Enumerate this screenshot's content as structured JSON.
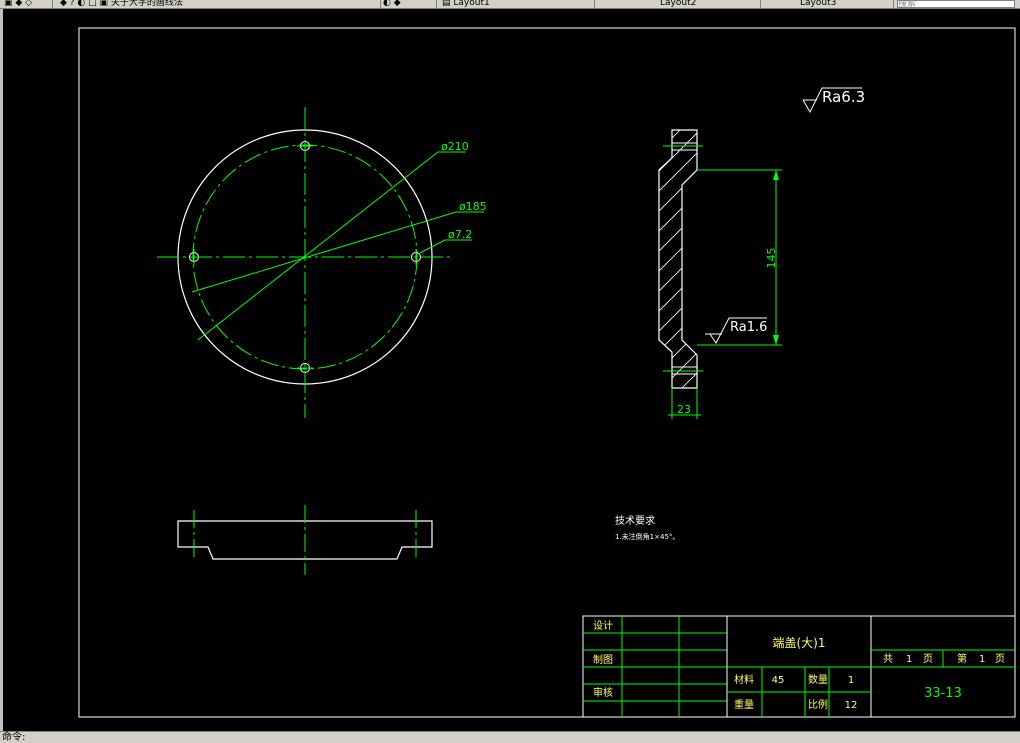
{
  "topbar": {
    "tab_title": "关于大学的画线法",
    "tab2": "Layout1",
    "tab3": "Layout2",
    "tab4": "Layout3",
    "search_placeholder": "搜索"
  },
  "status": {
    "text": "命令: "
  },
  "drawing": {
    "dim_d210": "ø210",
    "dim_d185": "ø185",
    "dim_d72": "ø7.2",
    "roughness_top": "Ra6.3",
    "roughness_face": "Ra1.6",
    "dim_145": "145",
    "dim_23": "23"
  },
  "tech_req": {
    "title": "技术要求",
    "line1": "1.未注倒角1×45°。"
  },
  "title_block": {
    "label_design": "设计",
    "label_draw": "制图",
    "label_review": "审核",
    "part_name": "端盖(大)1",
    "label_material": "材料",
    "material": "45",
    "label_quantity": "数量",
    "quantity": "1",
    "label_weight": "重量",
    "label_scale": "比例",
    "scale": "12",
    "sheets_total_label": "共",
    "sheets_total": "1",
    "sheets_unit": "页",
    "sheet_no_label": "第",
    "sheet_no": "1",
    "sheet_no_unit": "页",
    "drawing_no": "33-13"
  },
  "colors": {
    "background": "#000000",
    "outline": "#ffffff",
    "green": "#00ff00",
    "title_text": "#ffff66"
  }
}
